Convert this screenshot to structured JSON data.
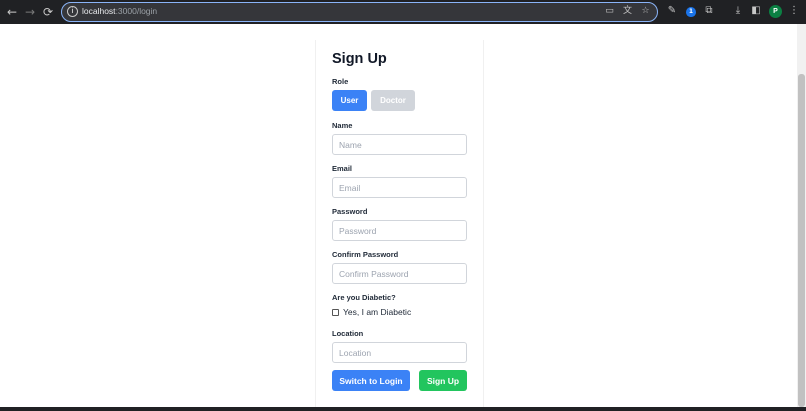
{
  "browser": {
    "url_host": "localhost",
    "url_path": ":3000/login",
    "profile_initial": "P",
    "extension_badge": "1"
  },
  "form": {
    "title": "Sign Up",
    "role_label": "Role",
    "role_options": [
      "User",
      "Doctor"
    ],
    "role_selected": "User",
    "name_label": "Name",
    "name_placeholder": "Name",
    "email_label": "Email",
    "email_placeholder": "Email",
    "password_label": "Password",
    "password_placeholder": "Password",
    "confirm_label": "Confirm Password",
    "confirm_placeholder": "Confirm Password",
    "diabetic_label": "Are you Diabetic?",
    "diabetic_checkbox_label": "Yes, I am Diabetic",
    "diabetic_checked": false,
    "location_label": "Location",
    "location_placeholder": "Location",
    "switch_button": "Switch to Login",
    "signup_button": "Sign Up"
  },
  "colors": {
    "primary": "#3b82f6",
    "success": "#22c55e",
    "disabled": "#d1d5db"
  }
}
